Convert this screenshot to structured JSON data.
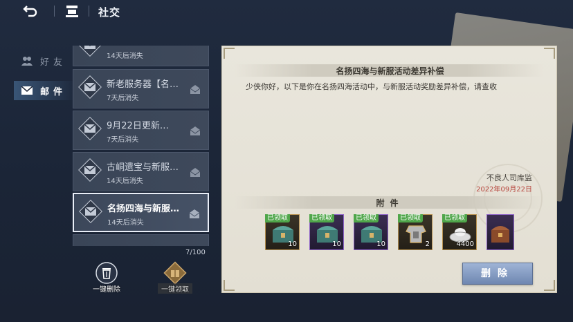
{
  "header": {
    "title": "社交"
  },
  "sidebar": {
    "tabs": [
      {
        "label": "好友",
        "active": false
      },
      {
        "label": "邮件",
        "active": true
      }
    ]
  },
  "mail_list": {
    "items": [
      {
        "title": "",
        "expiry": "14天后消失",
        "selected": false
      },
      {
        "title": "新老服务器【名…",
        "expiry": "7天后消失",
        "selected": false
      },
      {
        "title": "9月22日更新…",
        "expiry": "7天后消失",
        "selected": false
      },
      {
        "title": "古峒遗宝与新服…",
        "expiry": "14天后消失",
        "selected": false
      },
      {
        "title": "名扬四海与新服…",
        "expiry": "14天后消失",
        "selected": true
      }
    ],
    "count": "7/100"
  },
  "bottom_actions": {
    "delete_all_label": "一键删除",
    "claim_all_label": "一键领取"
  },
  "mail": {
    "title": "名扬四海与新服活动差异补偿",
    "body": "少侠你好，以下是你在名扬四海活动中，与新服活动奖励差异补偿，请查收",
    "sender": "不良人司库监",
    "date": "2022年09月22日",
    "attachments_label": "附件",
    "attachments": [
      {
        "icon": "chest-icon",
        "status": "已领取",
        "qty": "10",
        "rarity": "gold"
      },
      {
        "icon": "chest-icon",
        "status": "已领取",
        "qty": "10",
        "rarity": "purple"
      },
      {
        "icon": "chest-icon",
        "status": "已领取",
        "qty": "10",
        "rarity": "purple"
      },
      {
        "icon": "armor-icon",
        "status": "已领取",
        "qty": "2",
        "rarity": "gold"
      },
      {
        "icon": "silver-ingot-icon",
        "status": "已领取",
        "qty": "4400",
        "rarity": "gold"
      },
      {
        "icon": "treasure-box-icon",
        "status": "",
        "qty": "",
        "rarity": "purple"
      }
    ],
    "delete_label": "删除"
  },
  "colors": {
    "background": "#1d2638",
    "claimed_badge": "#4fa64a",
    "date": "#b6423a",
    "delete_button": "#7f97c2"
  }
}
